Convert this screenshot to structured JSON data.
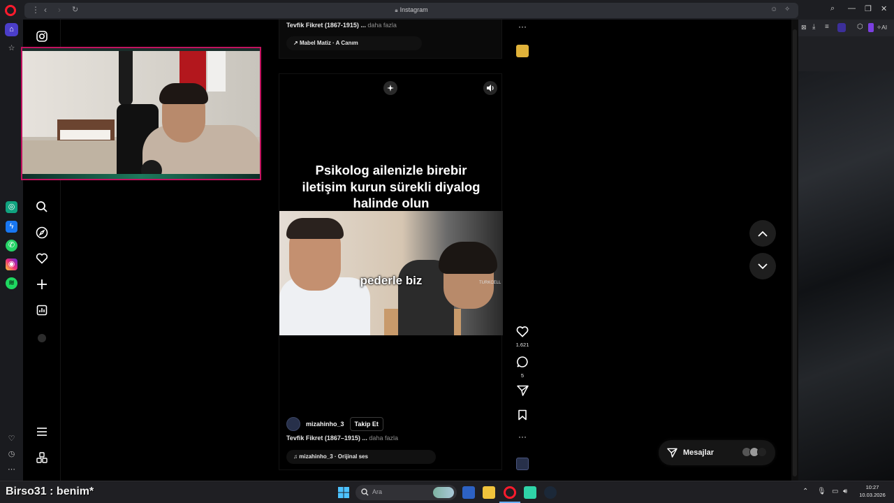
{
  "browser": {
    "tab_title": "Instagram",
    "nav": {
      "menu": "⋮",
      "back": "‹",
      "forward": "›",
      "reload": "↻"
    }
  },
  "feed": {
    "previous_post": {
      "caption_text": "Tevfik Fikret (1867-1915) ...",
      "more": "daha fazla",
      "audio": "Mabel Matiz · A Canım"
    },
    "reel": {
      "headline_lines": [
        "Psikolog ailenizle birebir",
        "iletişim kurun sürekli diyalog",
        "halinde olun"
      ],
      "video_caption": "pederle biz",
      "video_logo": "TURKCELL",
      "author": "mizahinho_3",
      "follow_label": "Takip Et",
      "caption_text": "Tevfik Fikret (1867–1915) ...",
      "more": "daha fazla",
      "audio": "mizahinho_3 · Orijinal ses",
      "likes": "1.621",
      "comments": "5"
    }
  },
  "messages": {
    "label": "Mesajlar"
  },
  "taskbar": {
    "stream_title": "Birso31 : benim*",
    "search_placeholder": "Ara",
    "time": "10:27",
    "date": "10.03.2026"
  },
  "colors": {
    "opera_red": "#ff1b2d",
    "webcam_border": "#c1125e",
    "background": "#000000"
  },
  "icons": [
    "opera-logo",
    "home",
    "star",
    "instagram",
    "search",
    "explore-compass",
    "heart",
    "plus",
    "insights",
    "menu",
    "more-apps",
    "chatgpt",
    "messenger",
    "whatsapp",
    "instagram-app",
    "spotify",
    "sparkle",
    "volume",
    "comment",
    "share",
    "bookmark",
    "more",
    "chevron-up",
    "chevron-down",
    "send",
    "windows",
    "file-explorer",
    "opera-browser",
    "steam"
  ]
}
